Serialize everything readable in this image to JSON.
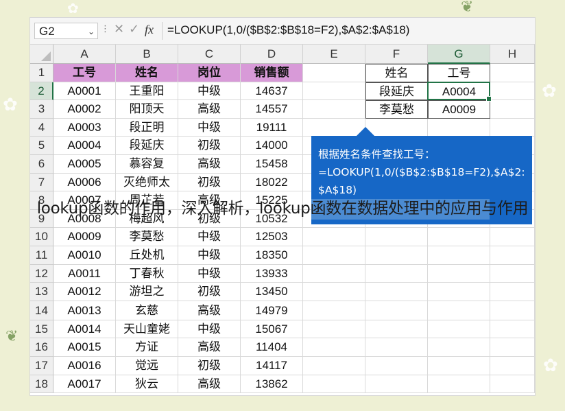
{
  "namebox": "G2",
  "formula": "=LOOKUP(1,0/($B$2:$B$18=F2),$A$2:$A$18)",
  "columns": [
    "A",
    "B",
    "C",
    "D",
    "E",
    "F",
    "G",
    "H"
  ],
  "selected_column": "G",
  "rows": [
    "1",
    "2",
    "3",
    "4",
    "5",
    "6",
    "7",
    "8",
    "9",
    "10",
    "11",
    "12",
    "13",
    "14",
    "15",
    "16",
    "17",
    "18"
  ],
  "selected_row": "2",
  "table_header": [
    "工号",
    "姓名",
    "岗位",
    "销售额"
  ],
  "table": [
    [
      "A0001",
      "王重阳",
      "中级",
      "14637"
    ],
    [
      "A0002",
      "阳顶天",
      "高级",
      "14557"
    ],
    [
      "A0003",
      "段正明",
      "中级",
      "19111"
    ],
    [
      "A0004",
      "段延庆",
      "初级",
      "14000"
    ],
    [
      "A0005",
      "慕容复",
      "高级",
      "15458"
    ],
    [
      "A0006",
      "灭绝师太",
      "初级",
      "18022"
    ],
    [
      "A0007",
      "周芷若",
      "高级",
      "15225"
    ],
    [
      "A0008",
      "梅超风",
      "初级",
      "10532"
    ],
    [
      "A0009",
      "李莫愁",
      "中级",
      "12503"
    ],
    [
      "A0010",
      "丘处机",
      "中级",
      "18350"
    ],
    [
      "A0011",
      "丁春秋",
      "中级",
      "13933"
    ],
    [
      "A0012",
      "游坦之",
      "初级",
      "13450"
    ],
    [
      "A0013",
      "玄慈",
      "高级",
      "14979"
    ],
    [
      "A0014",
      "天山童姥",
      "中级",
      "15067"
    ],
    [
      "A0015",
      "方证",
      "高级",
      "11404"
    ],
    [
      "A0016",
      "觉远",
      "初级",
      "14117"
    ],
    [
      "A0017",
      "狄云",
      "高级",
      "13862"
    ]
  ],
  "lookup": {
    "header": [
      "姓名",
      "工号"
    ],
    "rows": [
      [
        "段延庆",
        "A0004"
      ],
      [
        "李莫愁",
        "A0009"
      ]
    ]
  },
  "callout": {
    "line1": "根据姓名条件查找工号：",
    "line2": "=LOOKUP(1,0/($B$2:$B$18=F2),$A$2:",
    "line3": "$A$18)"
  },
  "watermark": "lookup函数的作用，深入解析，lookup函数在数据处理中的应用与作用",
  "colors": {
    "header_fill": "#d89ad8",
    "selection": "#217346",
    "callout": "#1667c6"
  }
}
